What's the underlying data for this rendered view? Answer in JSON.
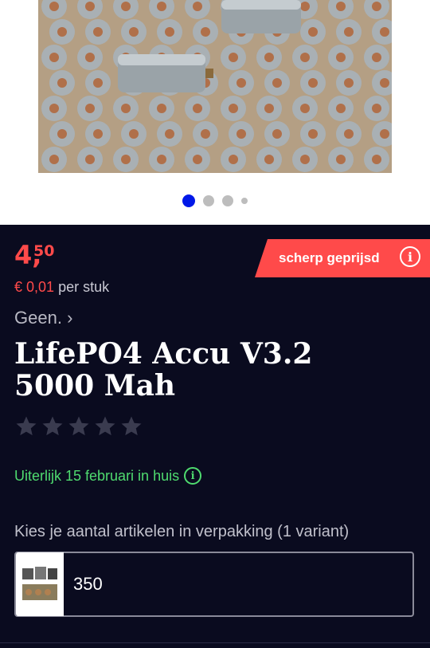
{
  "gallery": {
    "image_alt": "LifePO4 Accu product photo",
    "dot_count": 4,
    "active_index": 0
  },
  "price": {
    "main": "4,",
    "cents": "50",
    "color": "#ff4a4a"
  },
  "badge": {
    "label": "scherp geprijsd",
    "icon": "info-icon"
  },
  "unit_price": {
    "amount": "€ 0,01",
    "suffix": "per stuk"
  },
  "brand": {
    "label": "Geen.",
    "chevron": "›"
  },
  "product": {
    "title_line1": "LifePO4 Accu V3.2",
    "title_line2": "5000 Mah"
  },
  "rating": {
    "stars_filled": 0,
    "stars_total": 5
  },
  "delivery": {
    "text": "Uiterlijk 15 februari in huis",
    "color": "#4fdb6f"
  },
  "variant": {
    "label": "Kies je aantal artikelen in verpakking (1 variant)",
    "selected_value": "350"
  },
  "colors": {
    "background": "#0a0b1f",
    "accent_red": "#ff4a4a",
    "pager_active": "#0018e8"
  }
}
